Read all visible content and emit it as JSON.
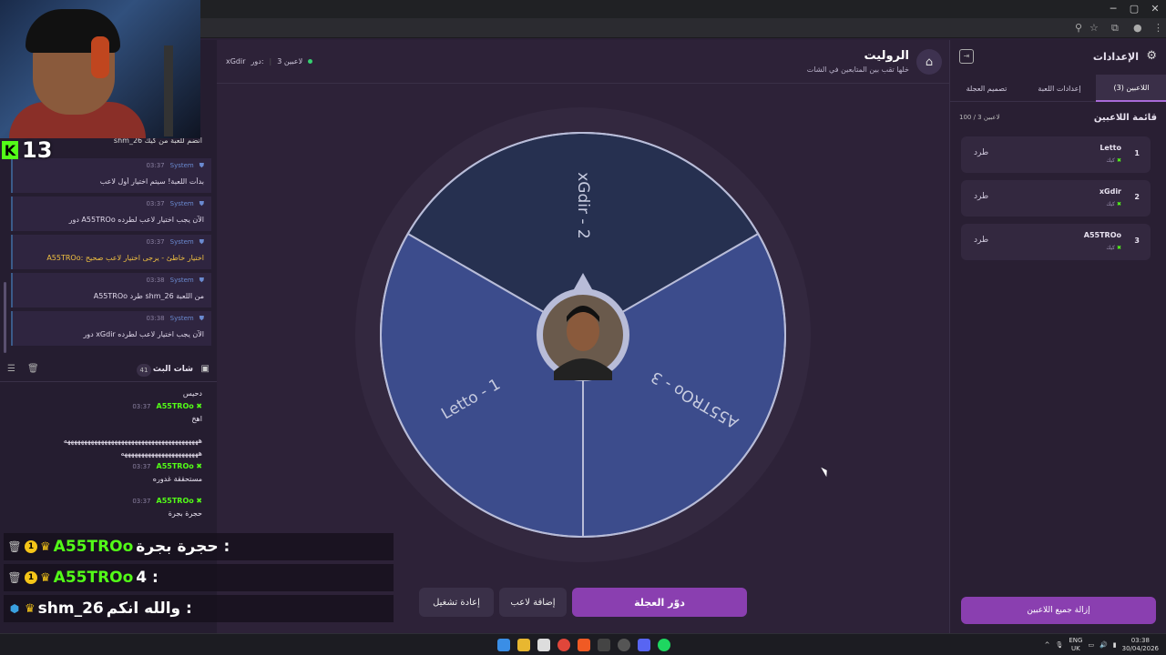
{
  "browser": {
    "window_controls": [
      "─",
      "▢",
      "✕"
    ],
    "toolbar_icons": [
      "search-icon",
      "star-icon",
      "extensions-icon",
      "profile-icon",
      "menu-icon"
    ]
  },
  "webcam": {
    "follower_count": "13"
  },
  "left_panel": {
    "system_messages": [
      {
        "author": "System",
        "time": "03:37",
        "text": "بدأت اللعبة! سيتم اختيار أول لاعب",
        "warn": false
      },
      {
        "author": "System",
        "time": "03:37",
        "text": "دور A55TROo الآن يجب اختيار لاعب لطرده",
        "warn": false
      },
      {
        "author": "System",
        "time": "03:37",
        "text": "A55TROo: اختيار خاطئ - يرجى اختيار لاعب صحيح",
        "warn": true
      },
      {
        "author": "System",
        "time": "03:38",
        "text": "A55TROo طرد shm_26 من اللعبة",
        "warn": false
      },
      {
        "author": "System",
        "time": "03:38",
        "text": "دور xGdir الآن يجب اختيار لاعب لطرده",
        "warn": false
      }
    ],
    "partial_top_text": "shm_26 انضم للعبة من كيك",
    "chat_header": {
      "title": "شات البث",
      "count": "41"
    },
    "chat": [
      {
        "type": "text",
        "text": "دحيس"
      },
      {
        "type": "msg",
        "user": "A55TROo",
        "time": "03:37",
        "text": "اهخ"
      },
      {
        "type": "text",
        "text": "ههههههههههههههههههههههههههههههههههههههههه"
      },
      {
        "type": "text",
        "text": "هههههههههههههههههههههههه"
      },
      {
        "type": "msg",
        "user": "A55TROo",
        "time": "03:37",
        "text": "مستحققة غدوره"
      },
      {
        "type": "msg",
        "user": "A55TROo",
        "time": "03:37",
        "text": "حجرة بجرة"
      }
    ]
  },
  "overlay_chat": [
    {
      "user": "A55TROo",
      "message": "حجرة بجرة :",
      "user_color": "green",
      "icon": "trash-icon"
    },
    {
      "user": "A55TROo",
      "message": "4 :",
      "user_color": "green",
      "icon": "trash-icon"
    },
    {
      "user": "shm_26",
      "message": "والله انكم :",
      "user_color": "white",
      "icon": "cube-icon"
    }
  ],
  "main": {
    "title": "الروليت",
    "subtitle": "خلها تقب بين المتابعين في الشات",
    "header_players": "3 لاعبين",
    "header_turn_label": "دور:",
    "header_turn_user": "xGdir",
    "wheel": {
      "segments": [
        {
          "label": "xGdir - 2",
          "color": "#263050"
        },
        {
          "label": "A55TROo - 3",
          "color": "#3c4c8c"
        },
        {
          "label": "Letto - 1",
          "color": "#3c4c8c"
        }
      ]
    },
    "buttons": {
      "spin": "دوّر العجلة",
      "add_player": "إضافة لاعب",
      "restart": "إعادة تشغيل"
    }
  },
  "right_panel": {
    "title": "الإعدادات",
    "tabs": [
      "اللاعبين (3)",
      "إعدادات اللعبة",
      "تصميم العجلة"
    ],
    "players_title": "قائمة اللاعبين",
    "players_count": "100 / 3 لاعبين",
    "players": [
      {
        "num": "1",
        "name": "Letto",
        "platform": "كيك",
        "kick_label": "طرد"
      },
      {
        "num": "2",
        "name": "xGdir",
        "platform": "كيك",
        "kick_label": "طرد"
      },
      {
        "num": "3",
        "name": "A55TROo",
        "platform": "كيك",
        "kick_label": "طرد"
      }
    ],
    "remove_all": "إزالة جميع اللاعبين"
  },
  "taskbar": {
    "lang_top": "ENG",
    "lang_bottom": "UK",
    "time": "03:38",
    "date": "30/04/2026"
  }
}
